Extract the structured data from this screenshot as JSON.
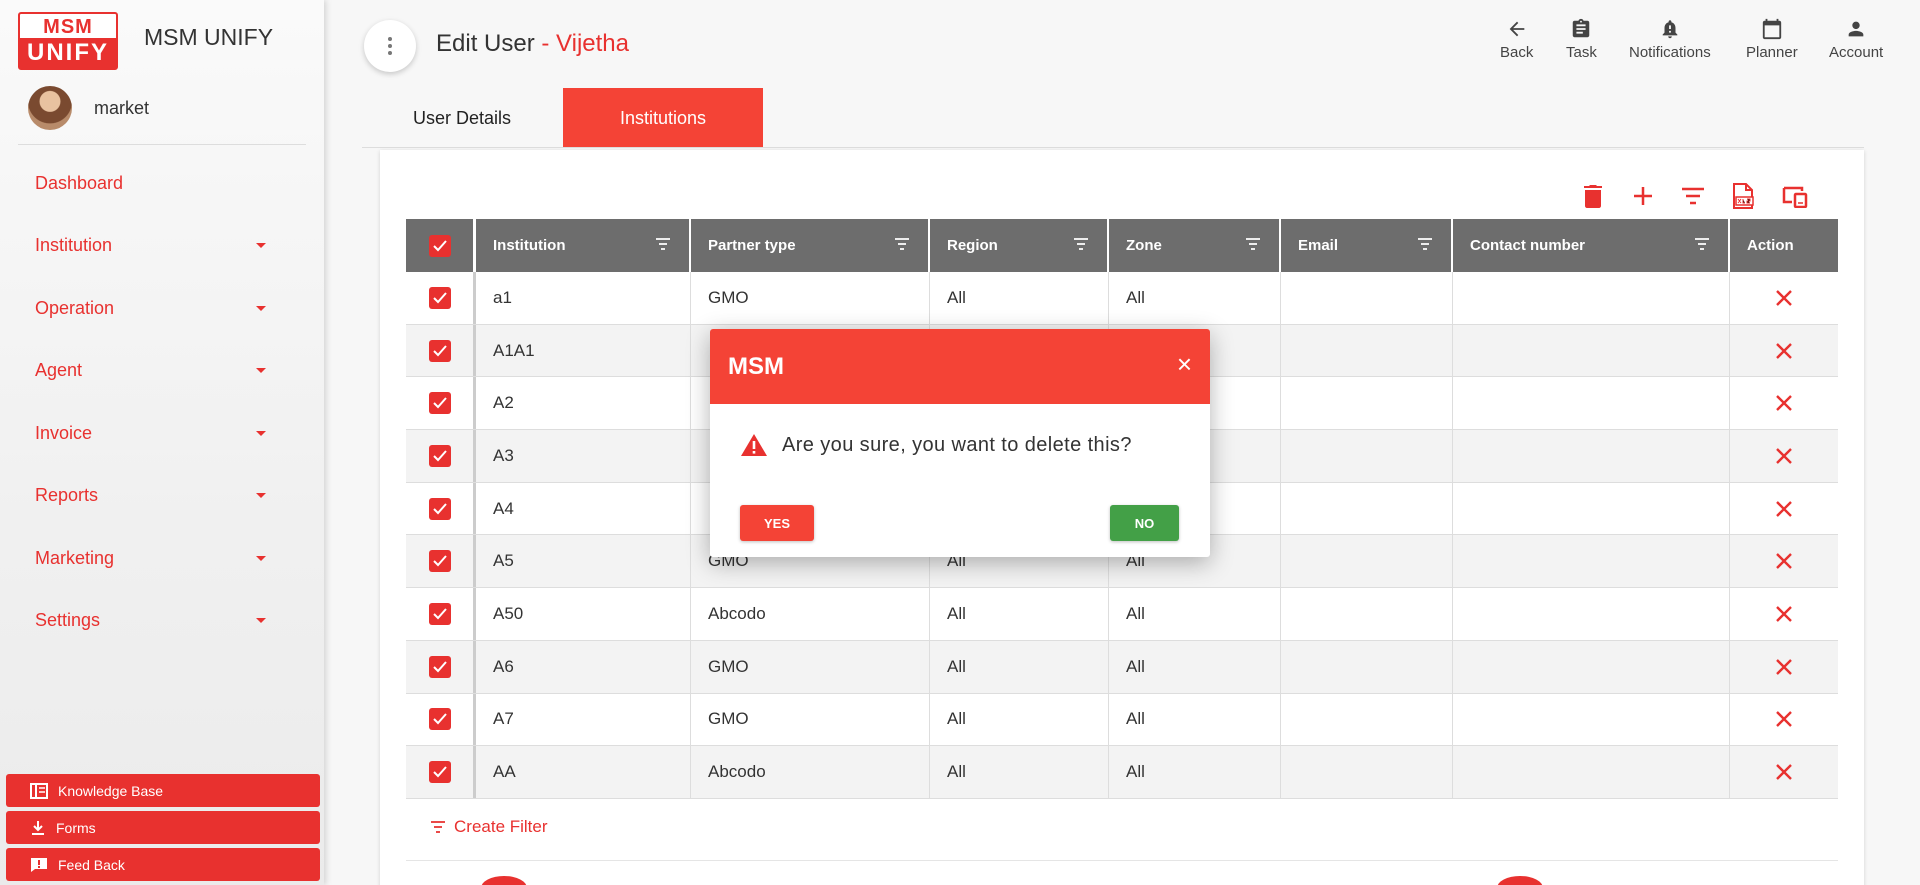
{
  "brand": {
    "line1": "MSM",
    "line2": "UNIFY",
    "app_name": "MSM UNIFY"
  },
  "user": {
    "name": "market"
  },
  "nav": [
    {
      "label": "Dashboard",
      "has_caret": false
    },
    {
      "label": "Institution",
      "has_caret": true
    },
    {
      "label": "Operation",
      "has_caret": true
    },
    {
      "label": "Agent",
      "has_caret": true
    },
    {
      "label": "Invoice",
      "has_caret": true
    },
    {
      "label": "Reports",
      "has_caret": true
    },
    {
      "label": "Marketing",
      "has_caret": true
    },
    {
      "label": "Settings",
      "has_caret": true
    }
  ],
  "sidebar_bottom": {
    "knowledge_base": "Knowledge Base",
    "forms": "Forms",
    "feedback": "Feed Back"
  },
  "header": {
    "title_prefix": "Edit User",
    "title_sep": " - ",
    "user_name": "Vijetha"
  },
  "topnav": {
    "back": "Back",
    "task": "Task",
    "notifications": "Notifications",
    "planner": "Planner",
    "account": "Account"
  },
  "tabs": {
    "user_details": "User Details",
    "institutions": "Institutions"
  },
  "table": {
    "headers": [
      "Institution",
      "Partner type",
      "Region",
      "Zone",
      "Email",
      "Contact number",
      "Action"
    ],
    "rows": [
      {
        "institution": "a1",
        "partner_type": "GMO",
        "region": "All",
        "zone": "All",
        "email": "",
        "contact": ""
      },
      {
        "institution": "A1A1",
        "partner_type": "",
        "region": "",
        "zone": "",
        "email": "",
        "contact": ""
      },
      {
        "institution": "A2",
        "partner_type": "",
        "region": "",
        "zone": "",
        "email": "",
        "contact": ""
      },
      {
        "institution": "A3",
        "partner_type": "",
        "region": "",
        "zone": "",
        "email": "",
        "contact": ""
      },
      {
        "institution": "A4",
        "partner_type": "",
        "region": "",
        "zone": "",
        "email": "",
        "contact": ""
      },
      {
        "institution": "A5",
        "partner_type": "GMO",
        "region": "All",
        "zone": "All",
        "email": "",
        "contact": ""
      },
      {
        "institution": "A50",
        "partner_type": "Abcodo",
        "region": "All",
        "zone": "All",
        "email": "",
        "contact": ""
      },
      {
        "institution": "A6",
        "partner_type": "GMO",
        "region": "All",
        "zone": "All",
        "email": "",
        "contact": ""
      },
      {
        "institution": "A7",
        "partner_type": "GMO",
        "region": "All",
        "zone": "All",
        "email": "",
        "contact": ""
      },
      {
        "institution": "AA",
        "partner_type": "Abcodo",
        "region": "All",
        "zone": "All",
        "email": "",
        "contact": ""
      }
    ]
  },
  "create_filter": "Create Filter",
  "dialog": {
    "title": "MSM",
    "close": "×",
    "message": "Are you sure, you want to delete this?",
    "yes": "YES",
    "no": "NO"
  },
  "colors": {
    "accent": "#e8312f",
    "header_gray": "#6d6d6d",
    "success": "#43a047"
  }
}
